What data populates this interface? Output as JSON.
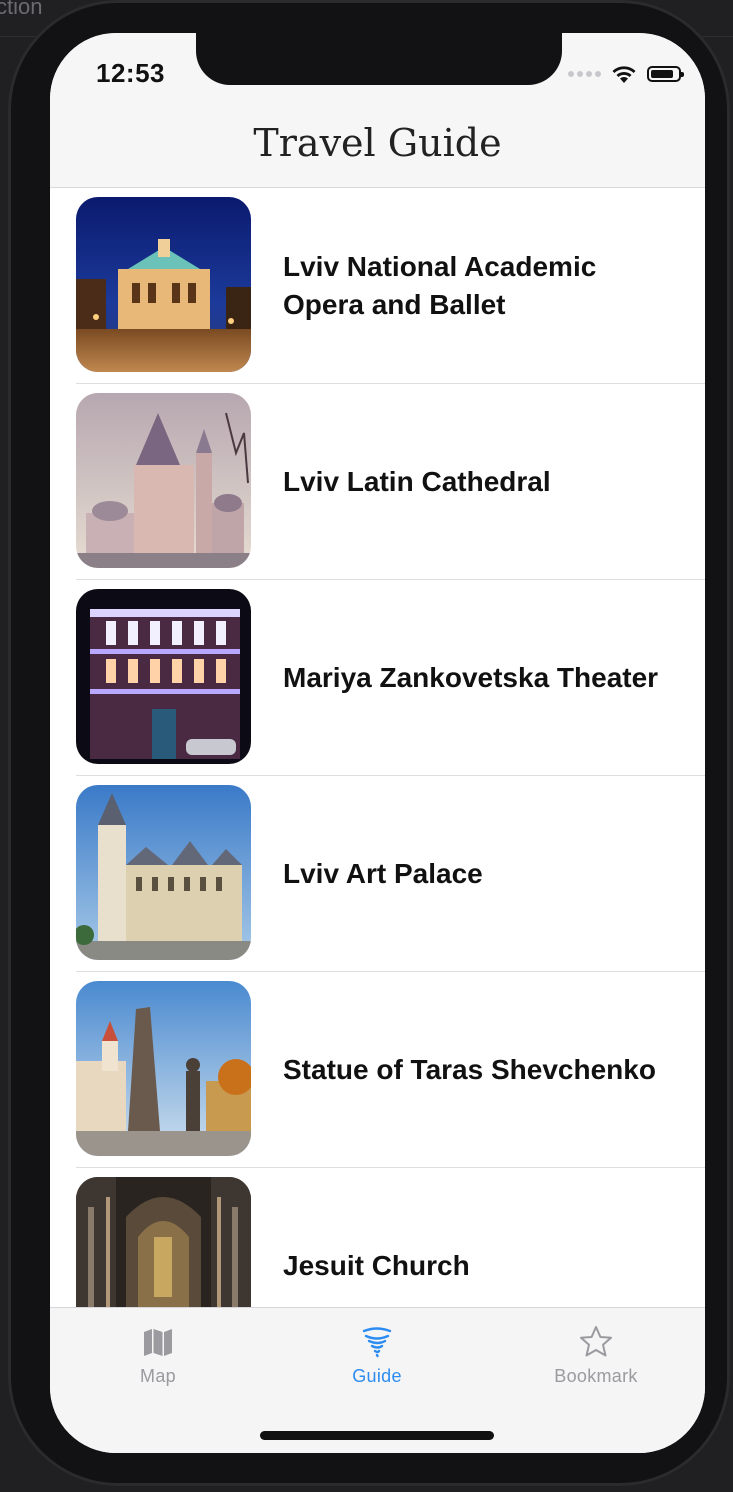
{
  "background": {
    "caption_fragment": "ction"
  },
  "status_bar": {
    "time": "12:53",
    "battery_level": 0.85
  },
  "navbar": {
    "title": "Travel Guide"
  },
  "places": [
    {
      "title": "Lviv National Academic Opera and Ballet",
      "image": "opera-house-night-photo"
    },
    {
      "title": "Lviv Latin Cathedral",
      "image": "cathedral-photo"
    },
    {
      "title": "Mariya Zankovetska Theater",
      "image": "theater-night-photo"
    },
    {
      "title": "Lviv Art Palace",
      "image": "art-palace-photo"
    },
    {
      "title": "Statue of Taras Shevchenko",
      "image": "shevchenko-statue-photo"
    },
    {
      "title": "Jesuit Church",
      "image": "church-interior-photo"
    }
  ],
  "tabbar": {
    "tabs": [
      {
        "label": "Map",
        "icon": "map-icon",
        "active": false
      },
      {
        "label": "Guide",
        "icon": "tornado-icon",
        "active": true
      },
      {
        "label": "Bookmark",
        "icon": "star-icon",
        "active": false
      }
    ],
    "active_color": "#2d8cf0",
    "inactive_color": "#9a9a9f"
  }
}
